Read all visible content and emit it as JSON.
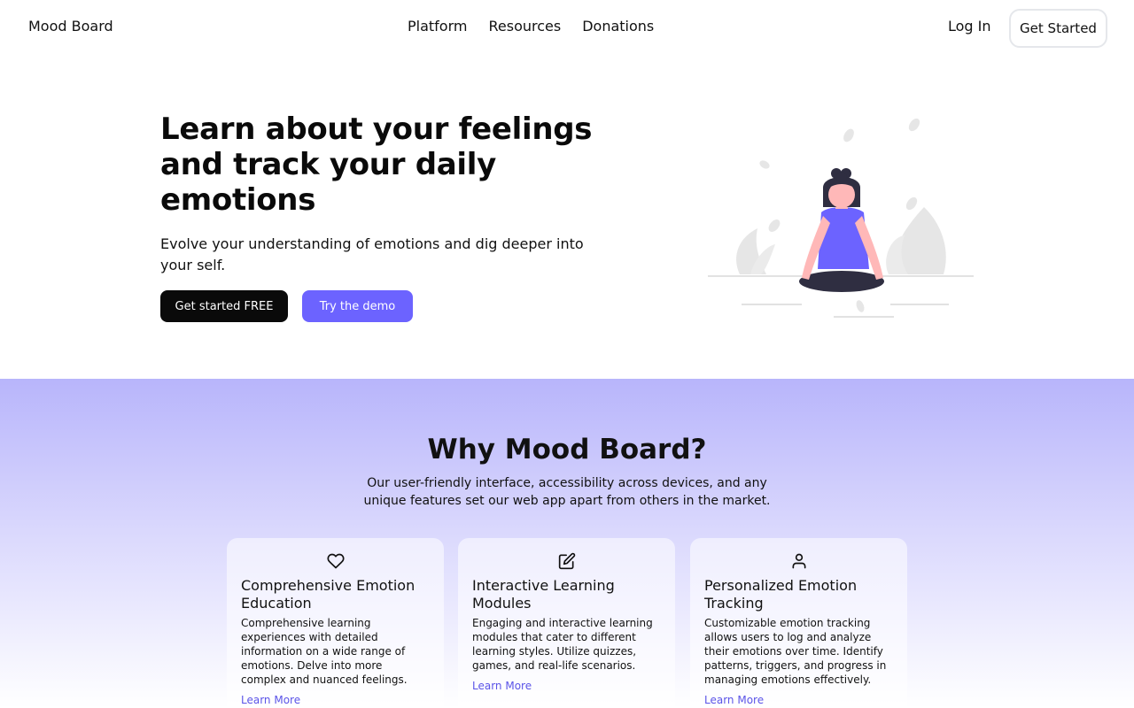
{
  "header": {
    "brand": "Mood Board",
    "nav": [
      "Platform",
      "Resources",
      "Donations"
    ],
    "login": "Log In",
    "get_started": "Get Started"
  },
  "hero": {
    "title": "Learn about your feelings and track your daily emotions",
    "subtitle": "Evolve your understanding of emotions and dig deeper into your self.",
    "primary_button": "Get started FREE",
    "secondary_button": "Try the demo"
  },
  "features": {
    "title": "Why Mood Board?",
    "subtitle": "Our user-friendly interface, accessibility across devices, and any unique features set our web app apart from others in the market.",
    "cards": [
      {
        "icon": "heart-icon",
        "title": "Comprehensive Emotion Education",
        "body": "Comprehensive learning experiences with detailed information on a wide range of emotions. Delve into more complex and nuanced feelings.",
        "link": "Learn More"
      },
      {
        "icon": "edit-icon",
        "title": "Interactive Learning Modules",
        "body": "Engaging and interactive learning modules that cater to different learning styles. Utilize quizzes, games, and real-life scenarios.",
        "link": "Learn More"
      },
      {
        "icon": "user-icon",
        "title": "Personalized Emotion Tracking",
        "body": "Customizable emotion tracking allows users to log and analyze their emotions over time. Identify patterns, triggers, and progress in managing emotions effectively.",
        "link": "Learn More"
      }
    ]
  },
  "colors": {
    "accent": "#6c63ff",
    "section_gradient_top": "#b8b5fb",
    "illustration_hair": "#2f2e41",
    "illustration_skin": "#ffb8b8"
  }
}
